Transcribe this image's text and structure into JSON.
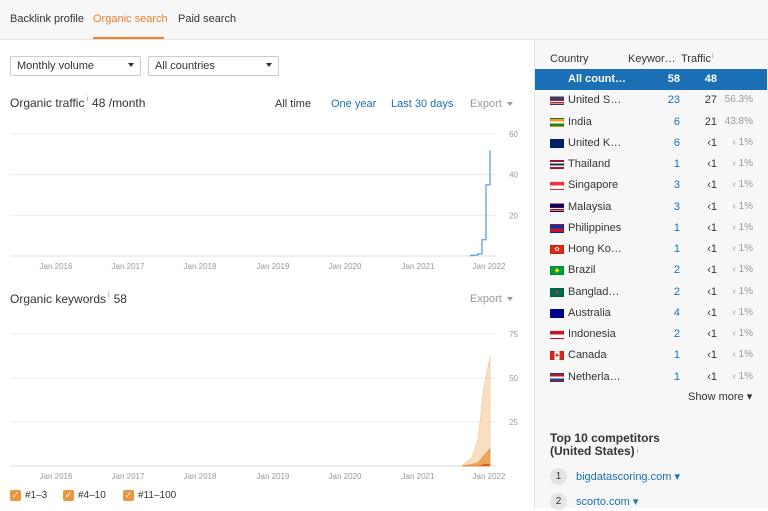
{
  "nav": {
    "tabs": [
      "Backlink profile",
      "Organic search",
      "Paid search"
    ]
  },
  "filters": {
    "volume": "Monthly volume",
    "country": "All countries"
  },
  "traffic": {
    "title": "Organic traffic",
    "info": "i",
    "value": "48 /month",
    "ranges": [
      "All time",
      "One year",
      "Last 30 days"
    ],
    "export": "Export"
  },
  "keywords": {
    "title": "Organic keywords",
    "info": "i",
    "value": "58",
    "export": "Export"
  },
  "legend": [
    "#1–3",
    "#4–10",
    "#11–100"
  ],
  "colors": {
    "accent": "#ee7f2d",
    "link": "#1a6fb5",
    "traffic_line": "#6aa9de",
    "keywords_area": "#f4c38f"
  },
  "countries_table": {
    "headers": [
      "Country",
      "Keywor…",
      "Traffic"
    ],
    "header_info": "i",
    "rows": [
      {
        "name": "All count…",
        "keywords": "58",
        "traffic": "48",
        "pct": "",
        "flag": "none"
      },
      {
        "name": "United S…",
        "keywords": "23",
        "traffic": "27",
        "pct": "56.3%",
        "flag": "us-flag"
      },
      {
        "name": "India",
        "keywords": "6",
        "traffic": "21",
        "pct": "43.8%",
        "flag": "in-flag"
      },
      {
        "name": "United K…",
        "keywords": "6",
        "traffic": "‹1",
        "pct": "‹ 1%",
        "flag": "gb-flag"
      },
      {
        "name": "Thailand",
        "keywords": "1",
        "traffic": "‹1",
        "pct": "‹ 1%",
        "flag": "th-flag"
      },
      {
        "name": "Singapore",
        "keywords": "3",
        "traffic": "‹1",
        "pct": "‹ 1%",
        "flag": "sg-flag"
      },
      {
        "name": "Malaysia",
        "keywords": "3",
        "traffic": "‹1",
        "pct": "‹ 1%",
        "flag": "my-flag"
      },
      {
        "name": "Philippines",
        "keywords": "1",
        "traffic": "‹1",
        "pct": "‹ 1%",
        "flag": "ph-flag"
      },
      {
        "name": "Hong Ko…",
        "keywords": "1",
        "traffic": "‹1",
        "pct": "‹ 1%",
        "flag": "hk-flag"
      },
      {
        "name": "Brazil",
        "keywords": "2",
        "traffic": "‹1",
        "pct": "‹ 1%",
        "flag": "br-flag"
      },
      {
        "name": "Banglad…",
        "keywords": "2",
        "traffic": "‹1",
        "pct": "‹ 1%",
        "flag": "bd-flag"
      },
      {
        "name": "Australia",
        "keywords": "4",
        "traffic": "‹1",
        "pct": "‹ 1%",
        "flag": "au-flag"
      },
      {
        "name": "Indonesia",
        "keywords": "2",
        "traffic": "‹1",
        "pct": "‹ 1%",
        "flag": "id-flag"
      },
      {
        "name": "Canada",
        "keywords": "1",
        "traffic": "‹1",
        "pct": "‹ 1%",
        "flag": "ca-flag"
      },
      {
        "name": "Netherla…",
        "keywords": "1",
        "traffic": "‹1",
        "pct": "‹ 1%",
        "flag": "nl-flag"
      }
    ],
    "show_more": "Show more ▾"
  },
  "competitors": {
    "title_line1": "Top 10 competitors",
    "title_line2": "(United States)",
    "info": "i",
    "items": [
      {
        "rank": "1",
        "domain": "bigdatascoring.com ▾"
      },
      {
        "rank": "2",
        "domain": "scorto.com ▾"
      }
    ]
  },
  "chart_data": [
    {
      "type": "line",
      "x": [
        "Jan 2016",
        "Jan 2017",
        "Jan 2018",
        "Jan 2019",
        "Jan 2020",
        "Jan 2021",
        "Jan 2022"
      ],
      "xlabel": "",
      "ylabel": "",
      "ylim": [
        0,
        60
      ],
      "yticks": [
        "20",
        "40",
        "60"
      ],
      "grid": true,
      "series": [
        {
          "values_by_month_from_2022_01": [
            1,
            8,
            35,
            52
          ]
        }
      ]
    },
    {
      "type": "area",
      "x": [
        "Jan 2016",
        "Jan 2017",
        "Jan 2018",
        "Jan 2019",
        "Jan 2020",
        "Jan 2021",
        "Jan 2022"
      ],
      "xlabel": "",
      "ylabel": "",
      "ylim": [
        0,
        75
      ],
      "yticks": [
        "25",
        "50",
        "75"
      ],
      "grid": true,
      "series": [
        {
          "name": "#1–3",
          "values_by_month_from_2022_01": [
            0,
            0,
            1,
            1
          ]
        },
        {
          "name": "#4–10",
          "values_by_month_from_2022_01": [
            1,
            2,
            6,
            10
          ]
        },
        {
          "name": "#11–100",
          "values_by_month_from_2022_01": [
            5,
            15,
            45,
            62
          ]
        }
      ]
    }
  ]
}
